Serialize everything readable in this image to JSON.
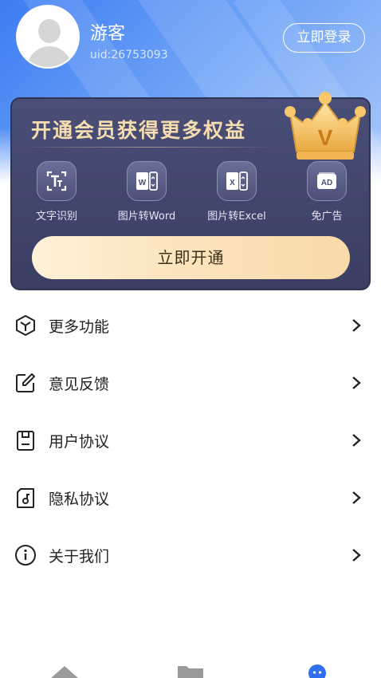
{
  "user": {
    "name": "游客",
    "uid": "uid:26753093",
    "login_label": "立即登录"
  },
  "vip": {
    "title": "开通会员获得更多权益",
    "features": [
      {
        "label": "文字识别",
        "icon": "text-recognition-icon"
      },
      {
        "label": "图片转Word",
        "icon": "image-to-word-icon"
      },
      {
        "label": "图片转Excel",
        "icon": "image-to-excel-icon"
      },
      {
        "label": "免广告",
        "icon": "ad-free-icon"
      }
    ],
    "open_label": "立即开通",
    "crown_letter": "V"
  },
  "menu": {
    "items": [
      {
        "label": "更多功能",
        "icon": "cube-icon"
      },
      {
        "label": "意见反馈",
        "icon": "edit-icon"
      },
      {
        "label": "用户协议",
        "icon": "document-icon"
      },
      {
        "label": "隐私协议",
        "icon": "privacy-file-icon"
      },
      {
        "label": "关于我们",
        "icon": "info-icon"
      }
    ]
  },
  "tabbar": {
    "tabs": [
      {
        "icon": "home-icon"
      },
      {
        "icon": "folder-icon"
      },
      {
        "icon": "profile-icon",
        "active": true
      }
    ]
  },
  "colors": {
    "hero_blue": "#3d7cf2",
    "vip_card": "#3a3e63",
    "vip_gold_text": "#f6dcae",
    "open_button": "#fbe3bb",
    "tab_active": "#2f6ff0"
  }
}
